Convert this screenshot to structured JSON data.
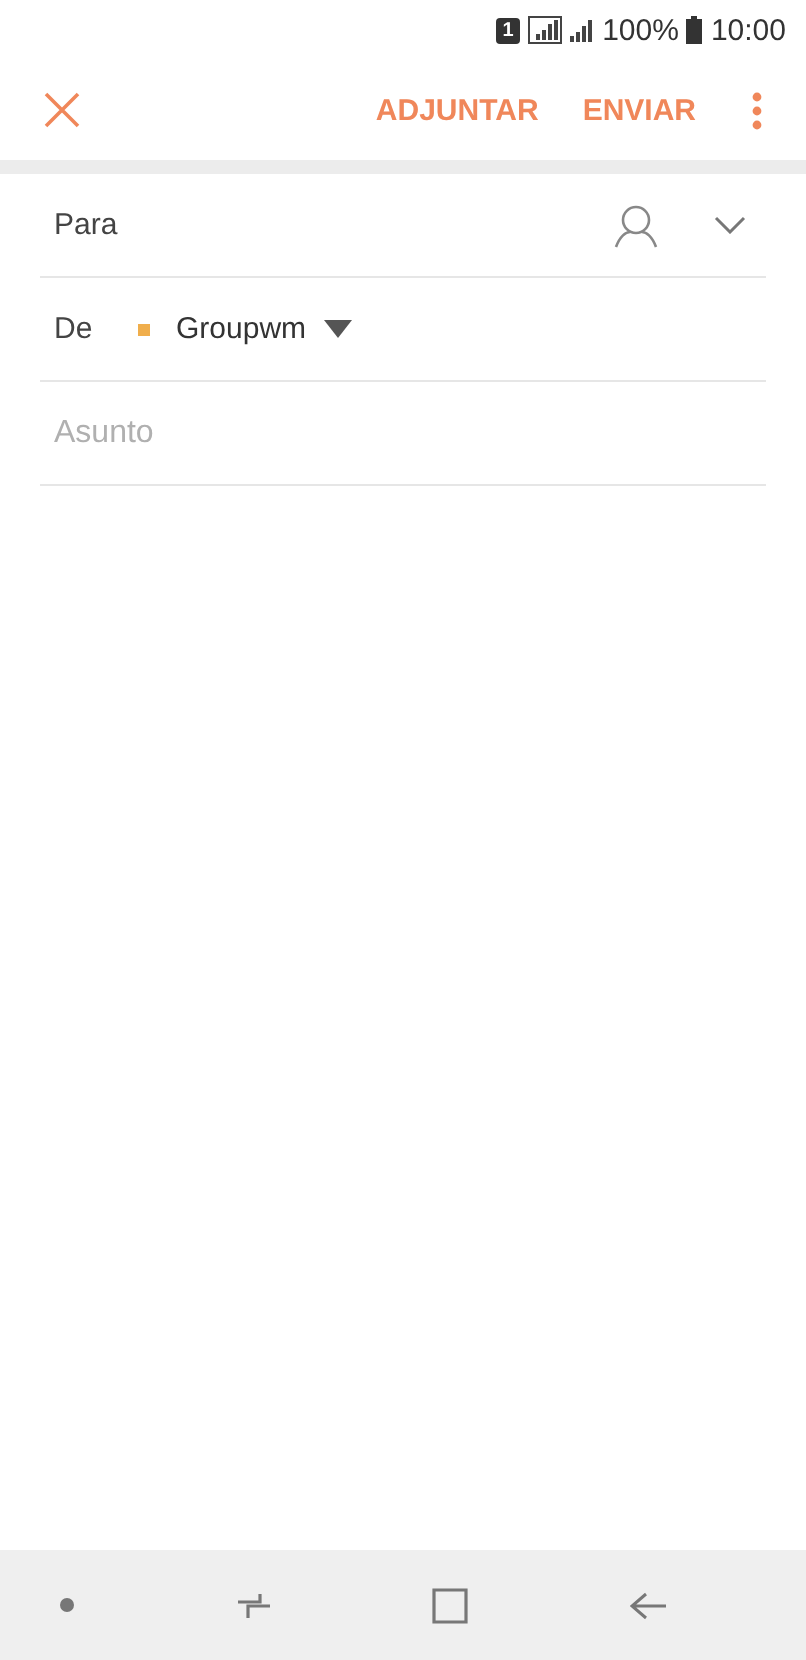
{
  "status_bar": {
    "sim": "1",
    "battery_text": "100%",
    "time": "10:00"
  },
  "toolbar": {
    "actions": [
      "ADJUNTAR",
      "ENVIAR"
    ]
  },
  "form": {
    "to_label": "Para",
    "from_label": "De",
    "from_account": {
      "name": "Groupwm",
      "color": "#f0ae4c"
    },
    "subject": {
      "placeholder": "Asunto"
    }
  }
}
